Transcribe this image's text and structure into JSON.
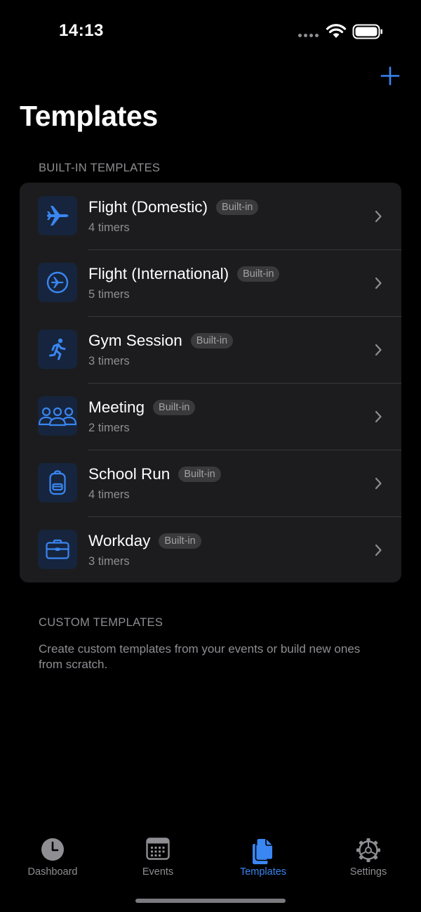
{
  "status_bar": {
    "time": "14:13"
  },
  "header": {
    "title": "Templates"
  },
  "colors": {
    "accent": "#3a86f3",
    "background": "#000000",
    "card": "#1c1c1e",
    "icon_tile": "#16253d"
  },
  "builtin_section": {
    "header": "BUILT-IN TEMPLATES",
    "items": [
      {
        "title": "Flight (Domestic)",
        "badge": "Built-in",
        "subtitle": "4 timers",
        "icon": "airplane-icon"
      },
      {
        "title": "Flight (International)",
        "badge": "Built-in",
        "subtitle": "5 timers",
        "icon": "airplane-circle-icon"
      },
      {
        "title": "Gym Session",
        "badge": "Built-in",
        "subtitle": "3 timers",
        "icon": "running-person-icon"
      },
      {
        "title": "Meeting",
        "badge": "Built-in",
        "subtitle": "2 timers",
        "icon": "people-group-icon"
      },
      {
        "title": "School Run",
        "badge": "Built-in",
        "subtitle": "4 timers",
        "icon": "backpack-icon"
      },
      {
        "title": "Workday",
        "badge": "Built-in",
        "subtitle": "3 timers",
        "icon": "briefcase-icon"
      }
    ]
  },
  "custom_section": {
    "header": "CUSTOM TEMPLATES",
    "description": "Create custom templates from your events or build new ones from scratch."
  },
  "tab_bar": {
    "tabs": [
      {
        "label": "Dashboard",
        "icon": "clock-icon",
        "active": false
      },
      {
        "label": "Events",
        "icon": "calendar-icon",
        "active": false
      },
      {
        "label": "Templates",
        "icon": "documents-icon",
        "active": true
      },
      {
        "label": "Settings",
        "icon": "gear-icon",
        "active": false
      }
    ]
  }
}
